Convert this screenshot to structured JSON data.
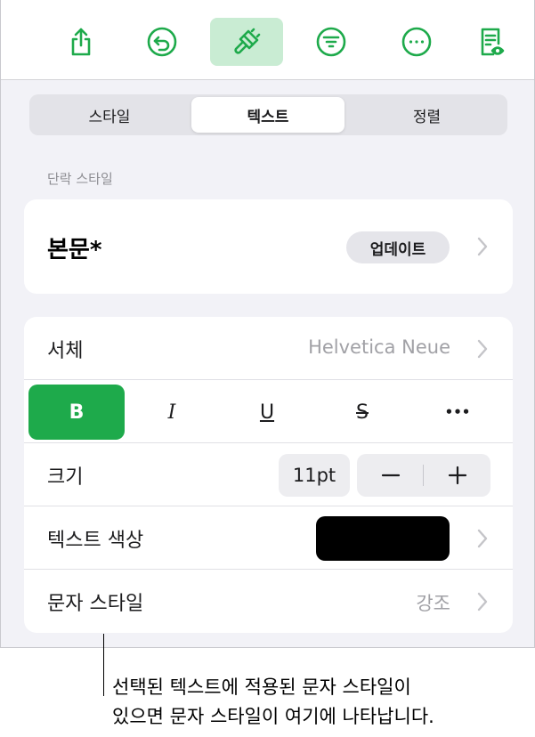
{
  "colors": {
    "accent": "#1eaa4b",
    "accent_light": "#c9ecd3",
    "text_color_swatch": "#000000"
  },
  "toolbar": {
    "icons": [
      "share-icon",
      "undo-icon",
      "format-brush-icon",
      "organize-icon",
      "more-icon",
      "reader-view-icon"
    ],
    "active": "format-brush-icon"
  },
  "tabs": [
    {
      "label": "스타일",
      "active": false
    },
    {
      "label": "텍스트",
      "active": true
    },
    {
      "label": "정렬",
      "active": false
    }
  ],
  "paragraph_style": {
    "section_label": "단락 스타일",
    "name": "본문*",
    "update_label": "업데이트"
  },
  "font": {
    "label": "서체",
    "value": "Helvetica Neue"
  },
  "text_styles": {
    "bold": "B",
    "italic": "I",
    "underline": "U",
    "strikethrough": "S",
    "more": "•••",
    "bold_on": true
  },
  "size": {
    "label": "크기",
    "value": "11pt"
  },
  "text_color": {
    "label": "텍스트 색상"
  },
  "char_style": {
    "label": "문자 스타일",
    "value": "강조"
  },
  "callout": {
    "line1": "선택된 텍스트에 적용된 문자 스타일이",
    "line2": "있으면 문자 스타일이 여기에 나타납니다."
  }
}
